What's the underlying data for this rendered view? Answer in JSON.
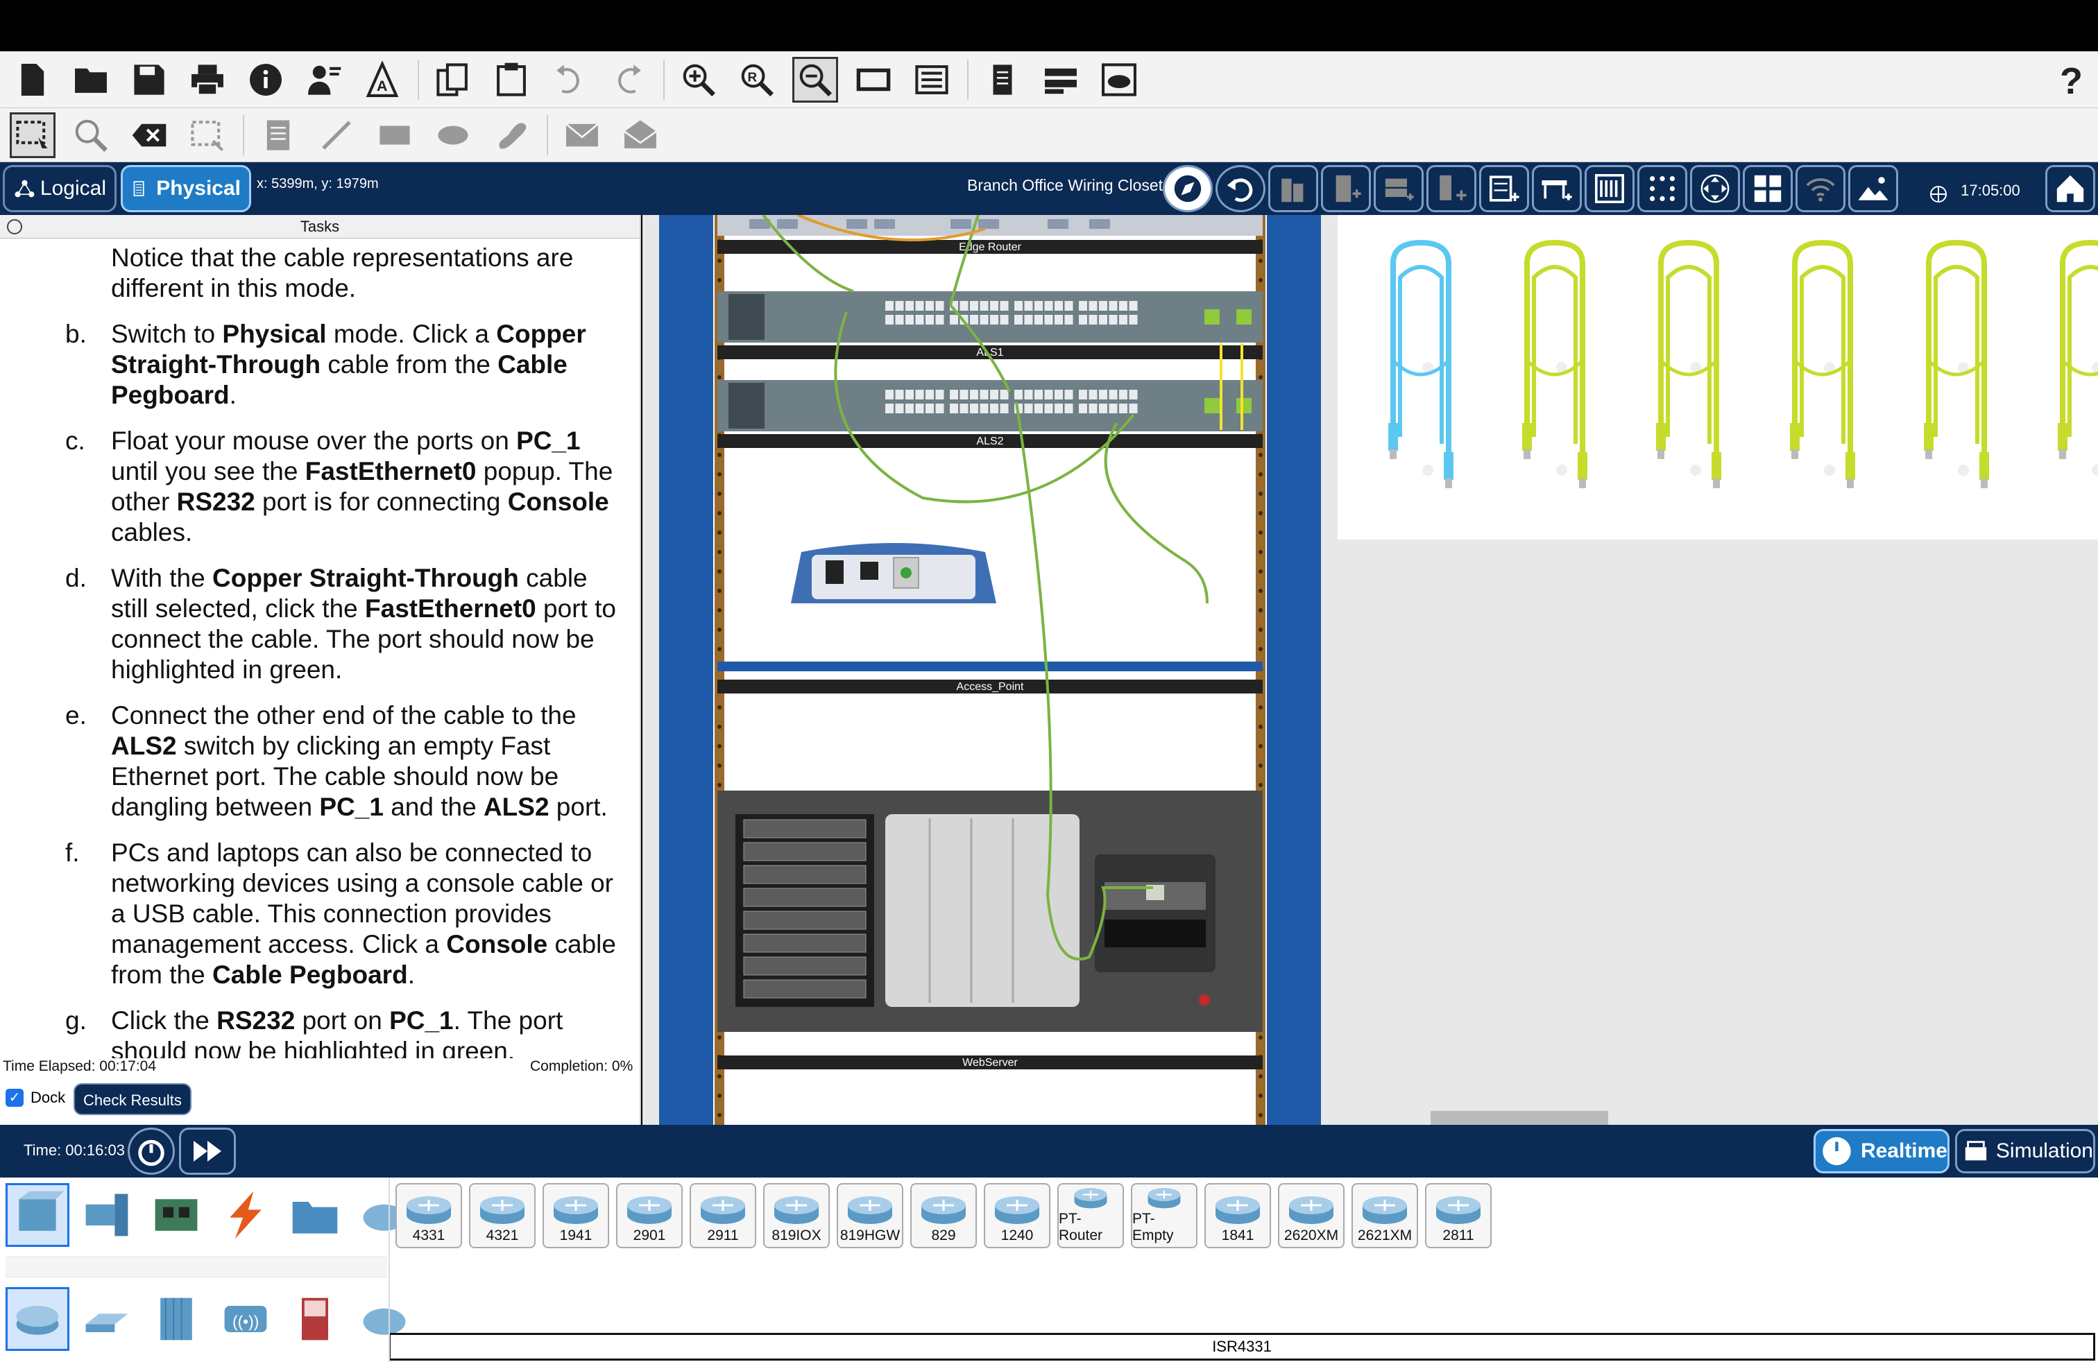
{
  "toolbar": {
    "help_label": "?"
  },
  "nav": {
    "logical_label": "Logical",
    "physical_label": "Physical",
    "coords": "x: 5399m, y: 1979m",
    "location": "Branch Office Wiring Closet",
    "clock": "17:05:00"
  },
  "tasks": {
    "header": "Tasks",
    "items": [
      {
        "letter": "",
        "html": "Notice that the cable representations are different in this mode."
      },
      {
        "letter": "b.",
        "html": "Switch to <b>Physical</b> mode. Click a <b>Copper Straight-Through</b> cable from the <b>Cable Pegboard</b>."
      },
      {
        "letter": "c.",
        "html": "Float your mouse over the ports on <b>PC_1</b> until you see the <b>FastEthernet0</b> popup. The other <b>RS232</b> port is for connecting <b>Console</b> cables."
      },
      {
        "letter": "d.",
        "html": "With the <b>Copper Straight-Through</b> cable still selected, click the <b>FastEthernet0</b> port to connect the cable. The port should now be highlighted in green."
      },
      {
        "letter": "e.",
        "html": "Connect the other end of the cable to the <b>ALS2</b> switch by clicking an empty Fast Ethernet port. The cable should now be dangling between <b>PC_1</b> and the <b>ALS2</b> port."
      },
      {
        "letter": "f.",
        "html": "PCs and laptops can also be connected to networking devices using a console cable or a USB cable. This connection provides management access. Click a <b>Console</b> cable from the <b>Cable Pegboard</b>."
      },
      {
        "letter": "g.",
        "html": "Click the <b>RS232</b> port on <b>PC_1</b>. The port should now be highlighted in green."
      }
    ],
    "time_elapsed": "Time Elapsed: 00:17:04",
    "completion": "Completion: 0%",
    "dock_label": "Dock",
    "check_results_label": "Check Results"
  },
  "rack": {
    "labels": [
      "Edge Router",
      "ALS1",
      "ALS2",
      "Access_Point",
      "WebServer"
    ]
  },
  "pegboard": {
    "cables": [
      {
        "color": "#5bc8f0"
      },
      {
        "color": "#c5dc2c"
      },
      {
        "color": "#c5dc2c"
      },
      {
        "color": "#c5dc2c"
      },
      {
        "color": "#c5dc2c"
      },
      {
        "color": "#c5dc2c"
      }
    ]
  },
  "simbar": {
    "time": "Time: 00:16:03",
    "realtime_label": "Realtime",
    "simulation_label": "Simulation"
  },
  "devices": {
    "models": [
      "4331",
      "4321",
      "1941",
      "2901",
      "2911",
      "819IOX",
      "819HGW",
      "829",
      "1240",
      "PT-Router",
      "PT-Empty",
      "1841",
      "2620XM",
      "2621XM",
      "2811"
    ],
    "selected_model": "ISR4331"
  },
  "colors": {
    "navy": "#0b2a54",
    "accent": "#1f7bc5",
    "rack_blue": "#1f5aa8",
    "cable_green": "#7cb342"
  }
}
